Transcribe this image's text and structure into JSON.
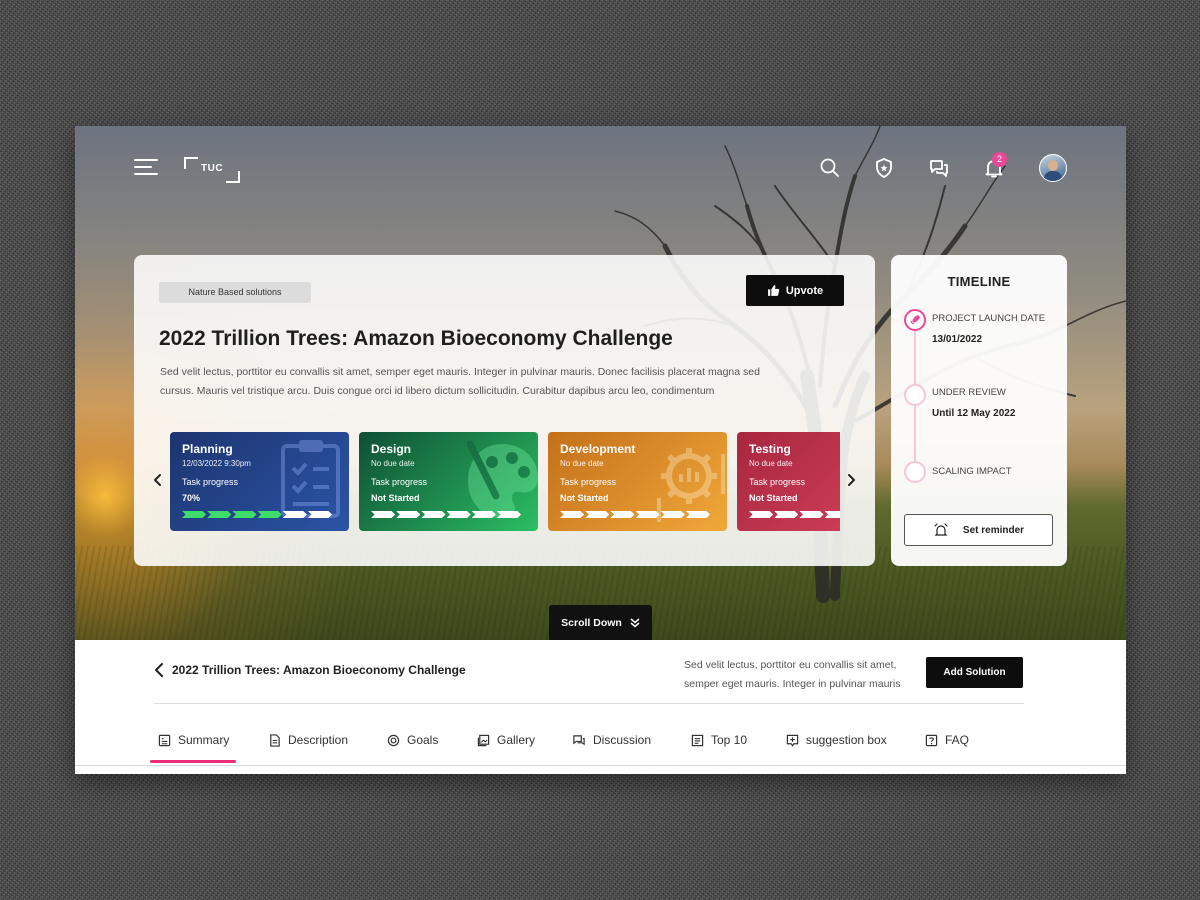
{
  "app": {
    "logo_text": "TUC",
    "notification_count": "2"
  },
  "colors": {
    "accent": "#ec4899",
    "dark": "#0d0d0d",
    "planning": "#1e3a7a",
    "design": "#1f8a4a",
    "development": "#d98a20",
    "testing": "#c0304f"
  },
  "hero": {
    "tag": "Nature Based solutions",
    "upvote_label": "Upvote",
    "title": "2022 Trillion Trees: Amazon Bioeconomy Challenge",
    "description": "Sed velit lectus, porttitor eu convallis sit amet, semper eget mauris. Integer in pulvinar mauris. Donec facilisis placerat magna sed cursus. Mauris vel tristique arcu. Duis congue orci id libero dictum sollicitudin. Curabitur dapibus arcu leo, condimentum",
    "stages": [
      {
        "name": "Planning",
        "date": "12/03/2022  9:30pm",
        "progress_label": "Task progress",
        "status": "70%",
        "progress": 0.7
      },
      {
        "name": "Design",
        "date": "No due date",
        "progress_label": "Task progress",
        "status": "Not Started",
        "progress": 0
      },
      {
        "name": "Development",
        "date": "No due date",
        "progress_label": "Task progress",
        "status": "Not Started",
        "progress": 0
      },
      {
        "name": "Testing",
        "date": "No due date",
        "progress_label": "Task progress",
        "status": "Not Started",
        "progress": 0
      }
    ],
    "scroll_down_label": "Scroll Down"
  },
  "timeline": {
    "title": "TIMELINE",
    "items": [
      {
        "label": "PROJECT LAUNCH DATE",
        "value": "13/01/2022"
      },
      {
        "label": "UNDER REVIEW",
        "value": "Until 12 May 2022"
      },
      {
        "label": "SCALING IMPACT",
        "value": ""
      }
    ],
    "reminder_label": "Set reminder"
  },
  "detail": {
    "title": "2022 Trillion Trees: Amazon Bioeconomy Challenge",
    "description": "Sed velit lectus, porttitor eu convallis sit amet, semper eget mauris. Integer in pulvinar mauris",
    "add_solution_label": "Add Solution"
  },
  "tabs": [
    {
      "label": "Summary",
      "icon": "summary-icon",
      "active": true
    },
    {
      "label": "Description",
      "icon": "document-icon"
    },
    {
      "label": "Goals",
      "icon": "target-icon"
    },
    {
      "label": "Gallery",
      "icon": "gallery-icon"
    },
    {
      "label": "Discussion",
      "icon": "chat-icon"
    },
    {
      "label": "Top 10",
      "icon": "list-icon"
    },
    {
      "label": "suggestion box",
      "icon": "suggestion-icon"
    },
    {
      "label": "FAQ",
      "icon": "faq-icon"
    }
  ]
}
